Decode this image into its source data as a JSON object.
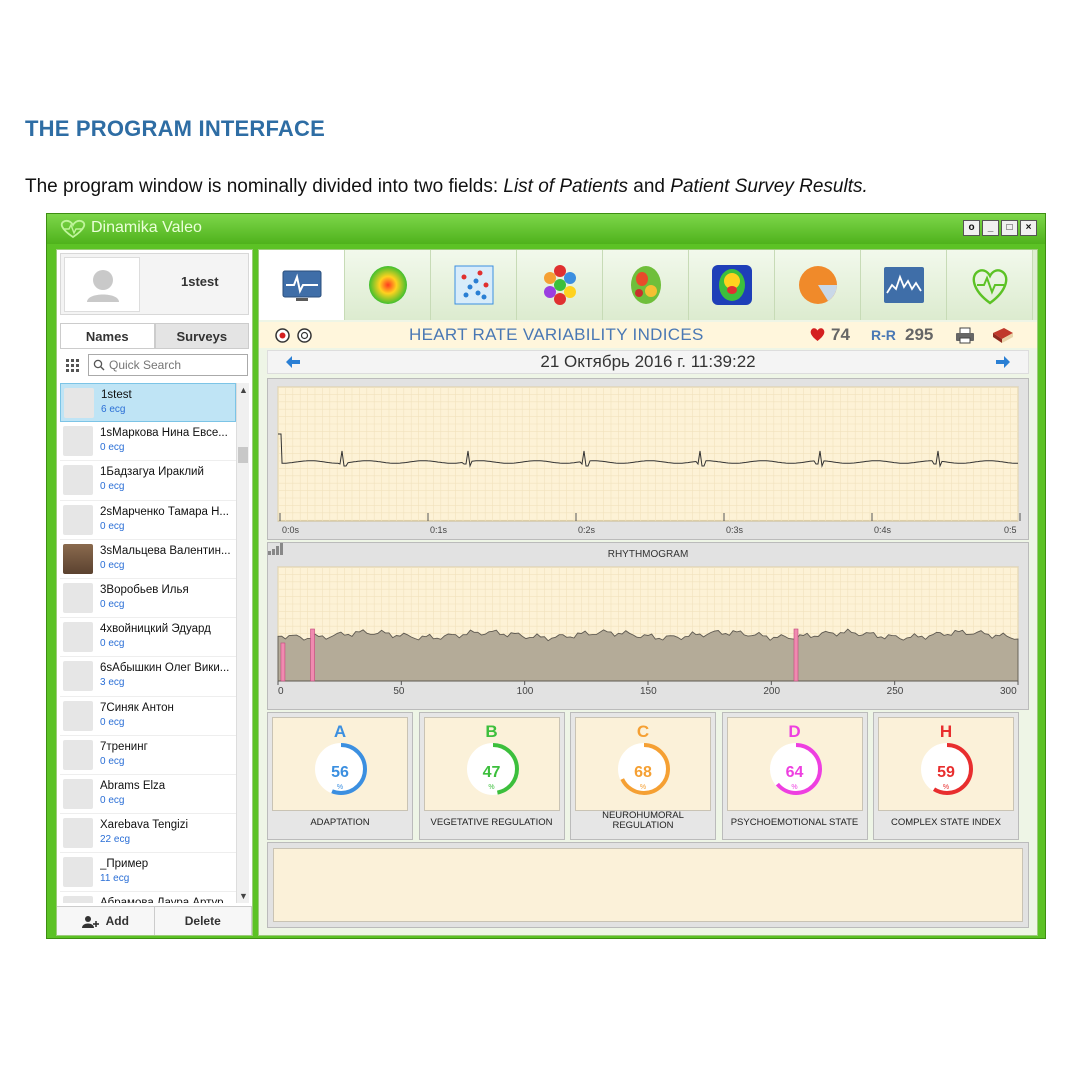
{
  "doc": {
    "heading": "THE PROGRAM INTERFACE",
    "text_before": "The program window is nominally divided into two fields: ",
    "em1": "List of Patients",
    "text_mid": " and ",
    "em2": "Patient Survey Results."
  },
  "window": {
    "title": "Dinamika Valeo",
    "controls": [
      "settings",
      "minimize",
      "maximize",
      "close"
    ]
  },
  "user_card": {
    "name": "1stest"
  },
  "left_tabs": [
    "Names",
    "Surveys"
  ],
  "search": {
    "placeholder": "Quick Search"
  },
  "patients": [
    {
      "name": "1stest",
      "ecg": "6 ecg",
      "selected": true
    },
    {
      "name": "1sМаркова Нина Евсе...",
      "ecg": "0 ecg"
    },
    {
      "name": "1Бадзагуа Ираклий",
      "ecg": "0 ecg"
    },
    {
      "name": "2sМарченко Тамара Н...",
      "ecg": "0 ecg"
    },
    {
      "name": "3sМальцева Валентин...",
      "ecg": "0 ecg",
      "photo": true
    },
    {
      "name": "3Воробьев Илья",
      "ecg": "0 ecg"
    },
    {
      "name": "4хвойницкий Эдуард",
      "ecg": "0 ecg"
    },
    {
      "name": "6sАбышкин Олег Вики...",
      "ecg": "3 ecg"
    },
    {
      "name": "7Синяк Антон",
      "ecg": "0 ecg"
    },
    {
      "name": "7тренинг",
      "ecg": "0 ecg"
    },
    {
      "name": "Abrams Elza",
      "ecg": "0 ecg"
    },
    {
      "name": "Xarebava Tengizi",
      "ecg": "22 ecg"
    },
    {
      "name": "_Пример",
      "ecg": "11 ecg"
    },
    {
      "name": "Абрамова Лаура Артур...",
      "ecg": ""
    }
  ],
  "bottom_buttons": {
    "add": "Add",
    "delete": "Delete"
  },
  "toolbar_icons": [
    "ecg-monitor",
    "heat-circle",
    "scatter-grid",
    "hexagon-cluster",
    "brain-map",
    "face-map",
    "pie-chart",
    "spectrum-chart",
    "heart-logo"
  ],
  "header": {
    "title": "HEART RATE VARIABILITY INDICES",
    "heart_rate": "74",
    "rr_label": "R-R",
    "rr_value": "295"
  },
  "date": "21 Октябрь 2016 г. 11:39:22",
  "ecg_ticks": [
    "0:0s",
    "0:1s",
    "0:2s",
    "0:3s",
    "0:4s",
    "0:5"
  ],
  "rhythmogram": {
    "label": "RHYTHMOGRAM",
    "ticks": [
      "0",
      "50",
      "100",
      "150",
      "200",
      "250",
      "300"
    ],
    "artifacts_at": [
      2,
      14,
      210
    ]
  },
  "indices": [
    {
      "letter": "A",
      "value": "56",
      "pct": "%",
      "fraction": 0.56,
      "color": "#3b8fe0",
      "label": "ADAPTATION"
    },
    {
      "letter": "B",
      "value": "47",
      "pct": "%",
      "fraction": 0.47,
      "color": "#3cbf3c",
      "label": "VEGETATIVE REGULATION"
    },
    {
      "letter": "C",
      "value": "68",
      "pct": "%",
      "fraction": 0.68,
      "color": "#f5a033",
      "label": "NEUROHUMORAL REGULATION"
    },
    {
      "letter": "D",
      "value": "64",
      "pct": "%",
      "fraction": 0.64,
      "color": "#ee3fe0",
      "label": "PSYCHOEMOTIONAL STATE"
    },
    {
      "letter": "H",
      "value": "59",
      "pct": "%",
      "fraction": 0.59,
      "color": "#e82e2e",
      "label": "COMPLEX STATE INDEX"
    }
  ]
}
